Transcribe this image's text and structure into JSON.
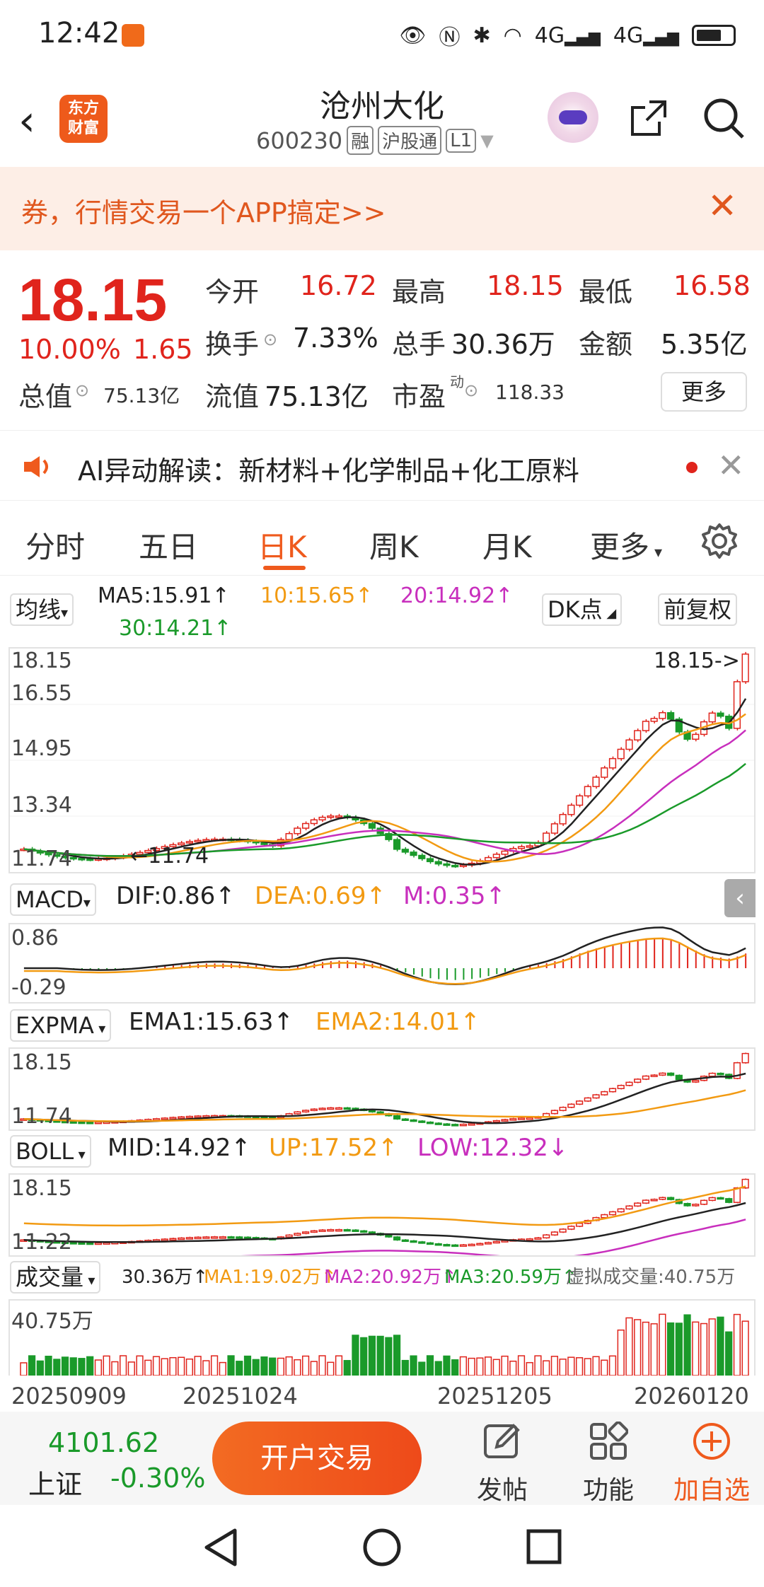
{
  "status_bar": {
    "time": "12:42",
    "network": "4G",
    "network2": "4G"
  },
  "header": {
    "stock_name": "沧州大化",
    "stock_code": "600230",
    "tags": [
      "融",
      "沪股通",
      "L1"
    ],
    "logo_text_1": "东方",
    "logo_text_2": "财富"
  },
  "banner": {
    "text": "券，行情交易一个APP搞定>>"
  },
  "quote": {
    "price": "18.15",
    "change_pct": "10.00%",
    "change_amt": "1.65",
    "open_label": "今开",
    "open": "16.72",
    "high_label": "最高",
    "high": "18.15",
    "low_label": "最低",
    "low": "16.58",
    "turnover_label": "换手",
    "turnover": "7.33%",
    "volume_label": "总手",
    "volume": "30.36万",
    "amount_label": "金额",
    "amount": "5.35亿",
    "mktcap_label": "总值",
    "mktcap": "75.13亿",
    "float_label": "流值",
    "float": "75.13亿",
    "pe_label": "市盈",
    "pe_sup": "动",
    "pe": "118.33",
    "more": "更多"
  },
  "ai": {
    "text": "AI异动解读：新材料+化学制品+化工原料"
  },
  "tabs": [
    "分时",
    "五日",
    "日K",
    "周K",
    "月K",
    "更多"
  ],
  "active_tab": "日K",
  "charts": {
    "ma_selector": "均线",
    "ma5": "MA5:15.91↑",
    "ma10": "10:15.65↑",
    "ma20": "20:14.92↑",
    "ma30": "30:14.21↑",
    "dk_button": "DK点",
    "fq_button": "前复权",
    "k_axis": [
      "18.15",
      "16.55",
      "14.95",
      "13.34",
      "11.74"
    ],
    "k_last_label": "18.15->",
    "k_low_label": "11.74",
    "macd_selector": "MACD",
    "dif": "DIF:0.86↑",
    "dea": "DEA:0.69↑",
    "m": "M:0.35↑",
    "macd_axis": [
      "0.86",
      "-0.29"
    ],
    "expma_selector": "EXPMA",
    "ema1": "EMA1:15.63↑",
    "ema2": "EMA2:14.01↑",
    "expma_axis": [
      "18.15",
      "11.74"
    ],
    "boll_selector": "BOLL",
    "mid": "MID:14.92↑",
    "up": "UP:17.52↑",
    "low": "LOW:12.32↓",
    "boll_axis": [
      "18.15",
      "11.22"
    ],
    "vol_selector": "成交量",
    "vol": "30.36万↑",
    "vma1": "MA1:19.02万↑",
    "vma2": "MA2:20.92万↑",
    "vma3": "MA3:20.59万↑",
    "virtual_vol": "虚拟成交量:40.75万",
    "vol_axis": [
      "40.75万"
    ],
    "dates": [
      "20250909",
      "20251024",
      "20251205",
      "20260120"
    ]
  },
  "bottom": {
    "index_value": "4101.62",
    "index_name": "上证",
    "index_change": "-0.30%",
    "trade_button": "开户交易",
    "post": "发帖",
    "function": "功能",
    "add_watch": "加自选"
  },
  "colors": {
    "up": "#e0241c",
    "down": "#1a9a2a",
    "accent": "#ef5a1d"
  }
}
